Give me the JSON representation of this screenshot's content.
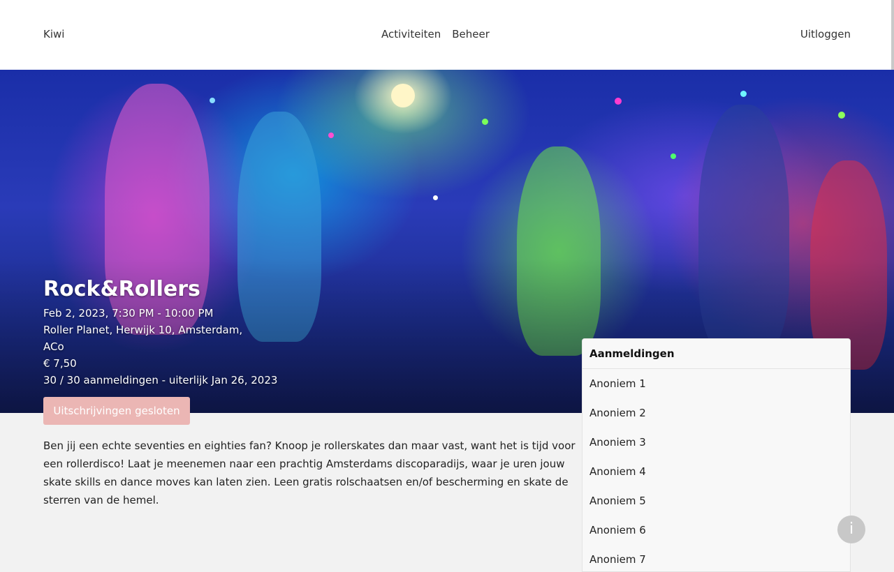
{
  "header": {
    "brand": "Kiwi",
    "nav": [
      {
        "label": "Activiteiten"
      },
      {
        "label": "Beheer"
      }
    ],
    "logout": "Uitloggen"
  },
  "event": {
    "title": "Rock&Rollers",
    "datetime": "Feb 2, 2023, 7:30 PM - 10:00 PM",
    "location": "Roller Planet, Herwijk 10, Amsterdam,",
    "organizer": "ACo",
    "price": "€ 7,50",
    "registrations": "30 / 30 aanmeldingen - uiterlijk Jan 26, 2023",
    "status_button": "Uitschrijvingen gesloten",
    "description": "Ben jij een echte seventies en eighties fan? Knoop je rollerskates dan maar vast, want het is tijd voor een rollerdisco! Laat je meenemen naar een prachtig Amsterdams discoparadijs, waar je uren jouw skate skills en dance moves kan laten zien. Leen gratis rolschaatsen en/of bescherming en skate de sterren van de hemel."
  },
  "panel": {
    "title": "Aanmeldingen",
    "items": [
      {
        "name": "Anoniem 1"
      },
      {
        "name": "Anoniem 2"
      },
      {
        "name": "Anoniem 3"
      },
      {
        "name": "Anoniem 4"
      },
      {
        "name": "Anoniem 5"
      },
      {
        "name": "Anoniem 6"
      },
      {
        "name": "Anoniem 7"
      }
    ]
  },
  "info_button": "i",
  "colors": {
    "status_button_bg": "#ebb6b4",
    "hero_base": "#1a2ea8"
  }
}
